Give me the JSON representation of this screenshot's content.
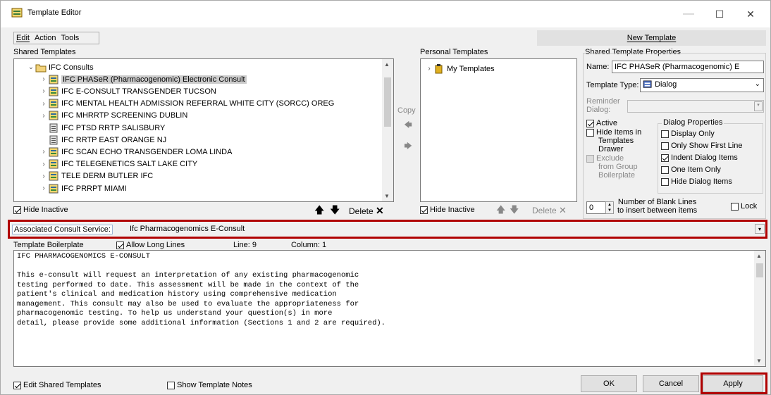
{
  "window": {
    "title": "Template Editor",
    "minimize": "—",
    "maximize": "☐",
    "close": "✕"
  },
  "menu": {
    "edit": "Edit",
    "action": "Action",
    "tools": "Tools"
  },
  "new_template_button": "New Template",
  "shared": {
    "label": "Shared Templates",
    "tree": [
      {
        "text": "IFC Consults",
        "level": 0,
        "expander": "⌄",
        "icon": "folder"
      },
      {
        "text": "IFC PHASeR (Pharmacogenomic) Electronic Consult",
        "level": 1,
        "expander": "›",
        "icon": "dialog",
        "selected": true
      },
      {
        "text": "IFC E-CONSULT TRANSGENDER TUCSON",
        "level": 1,
        "expander": "›",
        "icon": "dialog"
      },
      {
        "text": "IFC MENTAL HEALTH ADMISSION REFERRAL WHITE CITY (SORCC) OREG",
        "level": 1,
        "expander": "›",
        "icon": "dialog"
      },
      {
        "text": "IFC MHRRTP SCREENING DUBLIN",
        "level": 1,
        "expander": "›",
        "icon": "dialog"
      },
      {
        "text": "IFC PTSD RRTP SALISBURY",
        "level": 1,
        "expander": "",
        "icon": "doc"
      },
      {
        "text": "IFC RRTP EAST ORANGE NJ",
        "level": 1,
        "expander": "",
        "icon": "doc"
      },
      {
        "text": "IFC SCAN ECHO TRANSGENDER LOMA LINDA",
        "level": 1,
        "expander": "›",
        "icon": "dialog"
      },
      {
        "text": "IFC TELEGENETICS SALT LAKE CITY",
        "level": 1,
        "expander": "›",
        "icon": "dialog"
      },
      {
        "text": "TELE DERM BUTLER IFC",
        "level": 1,
        "expander": "›",
        "icon": "dialog"
      },
      {
        "text": "IFC PRRPT MIAMI",
        "level": 1,
        "expander": "›",
        "icon": "dialog"
      }
    ],
    "hide_inactive": "Hide Inactive",
    "delete": "Delete"
  },
  "copy_label": "Copy",
  "personal": {
    "label": "Personal Templates",
    "tree": [
      {
        "text": "My Templates",
        "expander": "›"
      }
    ],
    "hide_inactive": "Hide Inactive",
    "delete": "Delete"
  },
  "props": {
    "label": "Shared Template Properties",
    "name_label": "Name:",
    "name_value": "IFC PHASeR (Pharmacogenomic) E",
    "type_label": "Template Type:",
    "type_value": "Dialog",
    "reminder_label_1": "Reminder",
    "reminder_label_2": "Dialog:",
    "active": "Active",
    "hide_items_1": "Hide Items in",
    "hide_items_2": "Templates",
    "hide_items_3": "Drawer",
    "exclude_1": "Exclude",
    "exclude_2": "from Group",
    "exclude_3": "Boilerplate",
    "dialog_props_label": "Dialog Properties",
    "dialog_props": [
      {
        "label": "Display Only",
        "checked": false
      },
      {
        "label": "Only Show First Line",
        "checked": false
      },
      {
        "label": "Indent Dialog Items",
        "checked": true
      },
      {
        "label": "One Item Only",
        "checked": false
      },
      {
        "label": "Hide Dialog Items",
        "checked": false
      }
    ],
    "blank_lines_value": "0",
    "blank_lines_1": "Number of Blank Lines",
    "blank_lines_2": "to insert between items",
    "lock": "Lock"
  },
  "assoc": {
    "label": "Associated Consult Service:",
    "value": "Ifc Pharmacogenomics E-Consult"
  },
  "boiler": {
    "label": "Template Boilerplate",
    "allow_long": "Allow Long Lines",
    "line": "Line: 9",
    "column": "Column: 1",
    "lines": [
      "IFC PHARMACOGENOMICS E-CONSULT",
      "",
      "This e-consult will request an interpretation of any existing pharmacogenomic",
      "testing performed to date. This assessment will be made in the context of the",
      "patient's clinical and medication history using comprehensive medication",
      "management. This consult may also be used to evaluate the appropriateness for",
      "pharmacogenomic testing. To help us understand your question(s) in more",
      "detail, please provide some additional information (Sections 1 and 2 are required)."
    ]
  },
  "footer": {
    "edit_shared": "Edit Shared Templates",
    "show_notes": "Show Template Notes",
    "ok": "OK",
    "cancel": "Cancel",
    "apply": "Apply"
  },
  "colors": {
    "highlight": "#b00000",
    "selection": "#cccccc"
  }
}
